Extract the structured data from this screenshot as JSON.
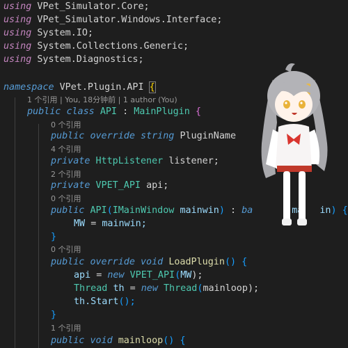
{
  "editor": {
    "lines": [
      [
        "using",
        "VPet_Simulator.Core;"
      ],
      [
        "using",
        "VPet_Simulator.Windows.Interface;"
      ],
      [
        "using",
        "System.IO;"
      ],
      [
        "using",
        "System.Collections.Generic;"
      ],
      [
        "using",
        "System.Diagnostics;"
      ],
      [
        "namespace",
        "VPet.Plugin.API",
        "{"
      ],
      [
        "public",
        "class",
        "API",
        ":",
        "MainPlugin",
        "{"
      ],
      [
        "public",
        "override",
        "string",
        "PluginName"
      ],
      [
        "private",
        "HttpListener",
        "listener;"
      ],
      [
        "private",
        "VPET_API",
        "api;"
      ],
      [
        "public",
        "API",
        "(",
        "IMainWindow",
        "mainwin",
        ")",
        ":",
        "ba",
        "ma",
        "in",
        ")",
        "{"
      ],
      [
        "MW",
        "=",
        "mainwin;"
      ],
      [
        "}"
      ],
      [
        "public",
        "override",
        "void",
        "LoadPlugin",
        "()",
        "{"
      ],
      [
        "api",
        "=",
        "new",
        "VPET_API",
        "(",
        "MW",
        ");"
      ],
      [
        "Thread",
        "th",
        "=",
        "new",
        "Thread",
        "(",
        "mainloop",
        ");"
      ],
      [
        "th.Start",
        "();"
      ],
      [
        "}"
      ],
      [
        "public",
        "void",
        "mainloop",
        "()",
        "{"
      ]
    ],
    "codelens": [
      "1 个引用 | You, 18分钟前 | 1 author (You)",
      "0 个引用",
      "4 个引用",
      "2 个引用",
      "0 个引用",
      "0 个引用",
      "1 个引用"
    ]
  }
}
